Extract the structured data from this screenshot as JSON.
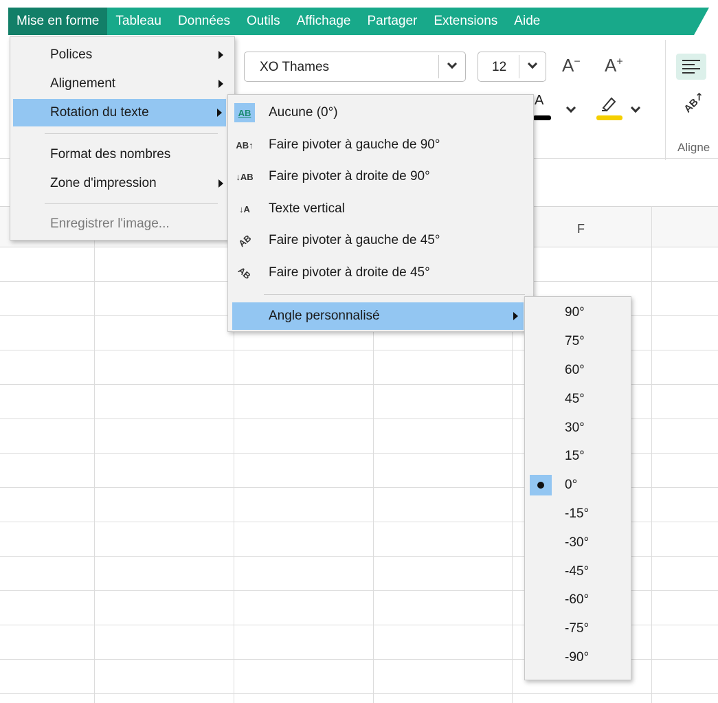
{
  "menubar": {
    "items": [
      "Mise en forme",
      "Tableau",
      "Données",
      "Outils",
      "Affichage",
      "Partager",
      "Extensions",
      "Aide"
    ]
  },
  "toolbar": {
    "font_name": "XO Thames",
    "font_size": "12",
    "grow_label": "A",
    "shrink_label": "A",
    "alignment_group_label": "Aligne"
  },
  "sheet": {
    "column_f": "F"
  },
  "format_menu": {
    "items": [
      {
        "label": "Polices",
        "submenu": true
      },
      {
        "label": "Alignement",
        "submenu": true
      },
      {
        "label": "Rotation du texte",
        "submenu": true,
        "selected": true
      },
      {
        "label": "Format des nombres",
        "submenu": false
      },
      {
        "label": "Zone d'impression",
        "submenu": true
      },
      {
        "label": "Enregistrer l'image...",
        "submenu": false,
        "disabled": true
      }
    ]
  },
  "rotation_menu": {
    "items": [
      {
        "label": "Aucune (0°)",
        "icon": "no-rotation-icon",
        "glyph": "AB",
        "checked": true
      },
      {
        "label": "Faire pivoter à gauche de 90°",
        "icon": "rotate-left-90-icon",
        "glyph": "AB↑"
      },
      {
        "label": "Faire pivoter à droite de 90°",
        "icon": "rotate-right-90-icon",
        "glyph": "↓AB"
      },
      {
        "label": "Texte vertical",
        "icon": "vertical-text-icon",
        "glyph": "↓A"
      },
      {
        "label": "Faire pivoter à gauche de 45°",
        "icon": "rotate-left-45-icon",
        "glyph": "AB"
      },
      {
        "label": "Faire pivoter à droite de 45°",
        "icon": "rotate-right-45-icon",
        "glyph": "AB"
      }
    ],
    "custom_angle": "Angle personnalisé"
  },
  "angle_menu": {
    "items": [
      "90°",
      "75°",
      "60°",
      "45°",
      "30°",
      "15°",
      "0°",
      "-15°",
      "-30°",
      "-45°",
      "-60°",
      "-75°",
      "-90°"
    ],
    "selected": "0°"
  },
  "colors": {
    "menubar": "#18a98a",
    "menubar_active": "#127f68",
    "highlight": "#93c6f2",
    "text_highlight": "#f5cf00"
  }
}
